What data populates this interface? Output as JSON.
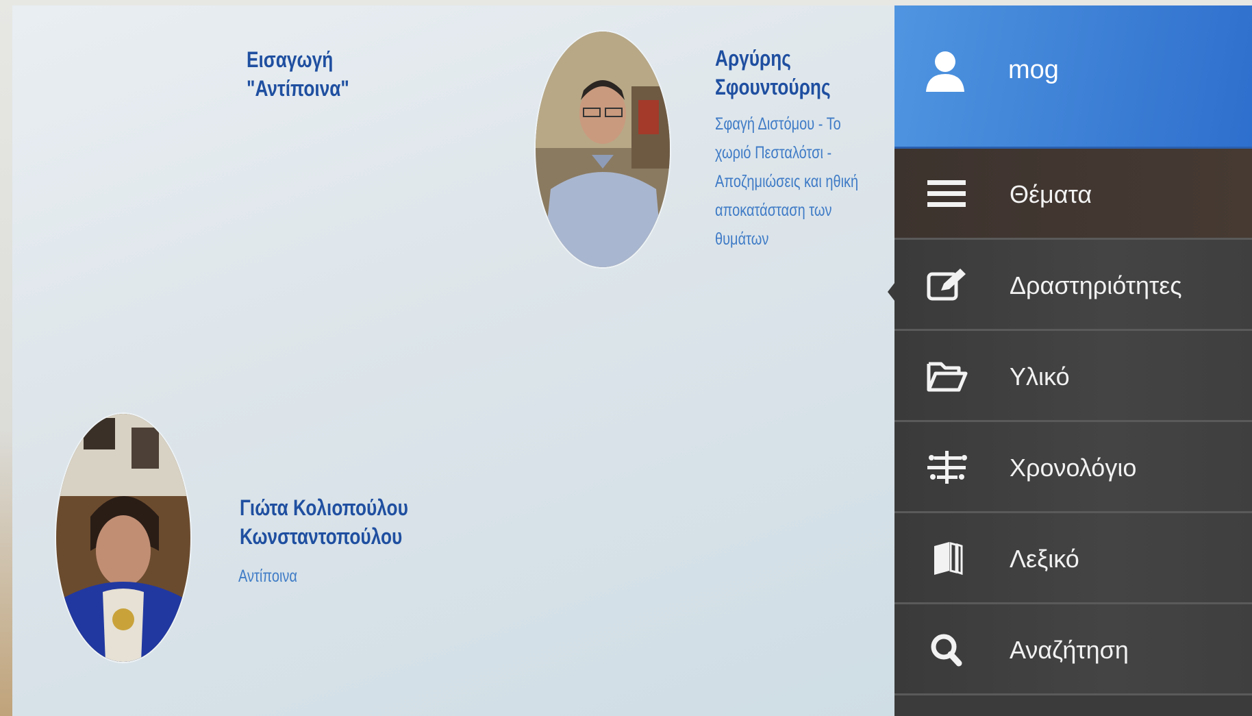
{
  "entries": [
    {
      "title": "Εισαγωγή\n\"Αντίποινα\""
    },
    {
      "title": "Αργύρης\nΣφουντούρης",
      "subtitle_lines": [
        "Σφαγή Διστόμου - Το",
        "χωριό Πεσταλότσι -",
        "Αποζημιώσεις και ηθική",
        "αποκατάσταση των",
        "θυμάτων"
      ]
    },
    {
      "title": "Γιώτα Κολιοπούλου\nΚωνσταντοπούλου",
      "subtitle": "Αντίποινα"
    }
  ],
  "sidebar": {
    "user": {
      "name": "mog",
      "icon": "user-icon"
    },
    "items": [
      {
        "label": "Θέματα",
        "icon": "hamburger-icon"
      },
      {
        "label": "Δραστηριότητες",
        "icon": "edit-icon",
        "active": true
      },
      {
        "label": "Υλικό",
        "icon": "folder-open-icon"
      },
      {
        "label": "Χρονολόγιο",
        "icon": "timeline-icon"
      },
      {
        "label": "Λεξικό",
        "icon": "books-icon"
      },
      {
        "label": "Αναζήτηση",
        "icon": "search-icon"
      }
    ]
  },
  "colors": {
    "title": "#1f4fa0",
    "subtitle": "#3f7bc6",
    "header": "#3f86da",
    "sidebar": "#3b3b3b"
  }
}
